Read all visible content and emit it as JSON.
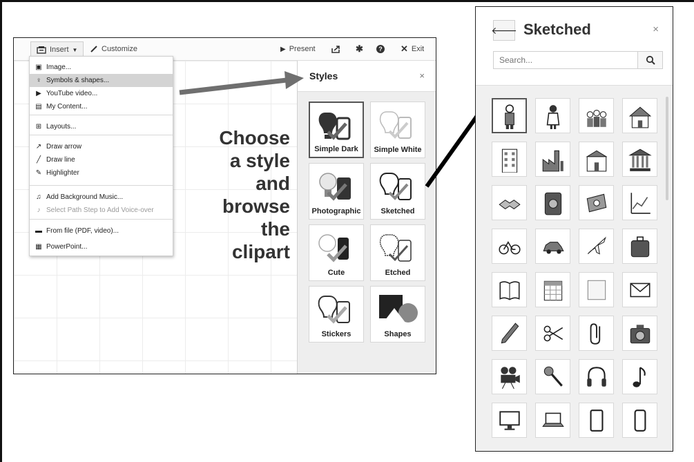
{
  "toolbar": {
    "insert": "Insert",
    "customize": "Customize",
    "present": "Present",
    "exit": "Exit"
  },
  "insert_menu": {
    "items": [
      {
        "label": "Image...",
        "icon": "image-icon"
      },
      {
        "label": "Symbols & shapes...",
        "icon": "lightbulb-icon",
        "selected": true
      },
      {
        "label": "YouTube video...",
        "icon": "youtube-icon"
      },
      {
        "label": "My Content...",
        "icon": "box-icon"
      },
      {
        "label": "Layouts...",
        "icon": "layouts-icon"
      },
      {
        "label": "Draw arrow",
        "icon": "arrow-icon"
      },
      {
        "label": "Draw line",
        "icon": "line-icon"
      },
      {
        "label": "Highlighter",
        "icon": "highlighter-icon"
      },
      {
        "label": "Add Background Music...",
        "icon": "music-file-icon"
      },
      {
        "label": "Select Path Step to Add Voice-over",
        "icon": "music-note-icon",
        "disabled": true
      },
      {
        "label": "From file (PDF, video)...",
        "icon": "file-icon"
      },
      {
        "label": "PowerPoint...",
        "icon": "powerpoint-icon"
      }
    ]
  },
  "styles_panel": {
    "title": "Styles",
    "close": "×",
    "tiles": [
      {
        "label": "Simple Dark",
        "active": true
      },
      {
        "label": "Simple White"
      },
      {
        "label": "Photographic"
      },
      {
        "label": "Sketched"
      },
      {
        "label": "Cute"
      },
      {
        "label": "Etched"
      },
      {
        "label": "Stickers"
      },
      {
        "label": "Shapes"
      }
    ]
  },
  "caption": {
    "lines": [
      "Choose",
      "a style",
      "and",
      "browse",
      "the",
      "clipart"
    ]
  },
  "sketched_panel": {
    "title": "Sketched",
    "close": "×",
    "search_placeholder": "Search...",
    "clipart": [
      "businessman",
      "businesswoman",
      "group",
      "house",
      "office-building",
      "factory",
      "school",
      "bank",
      "handshake",
      "safe",
      "money",
      "chart",
      "bicycle",
      "car",
      "airplane",
      "suitcase",
      "book",
      "calendar",
      "sticky-note",
      "envelope",
      "pencil",
      "scissors",
      "paperclip",
      "camera",
      "movie-camera",
      "microphone",
      "headphones",
      "music-note",
      "monitor",
      "laptop",
      "tablet",
      "phone"
    ]
  },
  "colors": {
    "arrow": "#6f6f6f",
    "pointer": "#000000",
    "panel_bg": "#eeeeee"
  }
}
